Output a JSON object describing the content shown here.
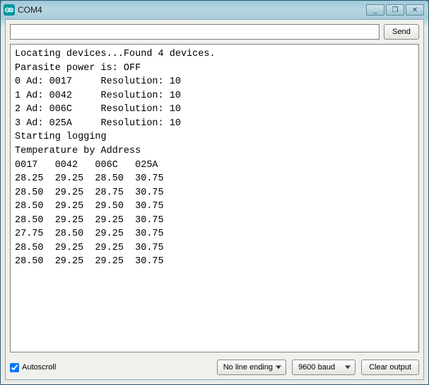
{
  "window": {
    "title": "COM4",
    "icon": "arduino-icon",
    "controls": {
      "min": "_",
      "max": "❐",
      "close": "✕"
    }
  },
  "sendRow": {
    "input": {
      "value": "",
      "placeholder": ""
    },
    "sendLabel": "Send"
  },
  "terminal": {
    "lines": [
      "Locating devices...Found 4 devices.",
      "Parasite power is: OFF",
      "0 Ad: 0017     Resolution: 10",
      "1 Ad: 0042     Resolution: 10",
      "2 Ad: 006C     Resolution: 10",
      "3 Ad: 025A     Resolution: 10",
      "Starting logging",
      "Temperature by Address",
      "0017   0042   006C   025A",
      "28.25  29.25  28.50  30.75",
      "28.50  29.25  28.75  30.75",
      "28.50  29.25  29.50  30.75",
      "28.50  29.25  29.25  30.75",
      "27.75  28.50  29.25  30.75",
      "28.50  29.25  29.25  30.75",
      "28.50  29.25  29.25  30.75"
    ]
  },
  "bottomBar": {
    "autoscroll": {
      "label": "Autoscroll",
      "checked": true
    },
    "lineEnding": {
      "selected": "No line ending"
    },
    "baud": {
      "selected": "9600 baud"
    },
    "clearLabel": "Clear output"
  }
}
